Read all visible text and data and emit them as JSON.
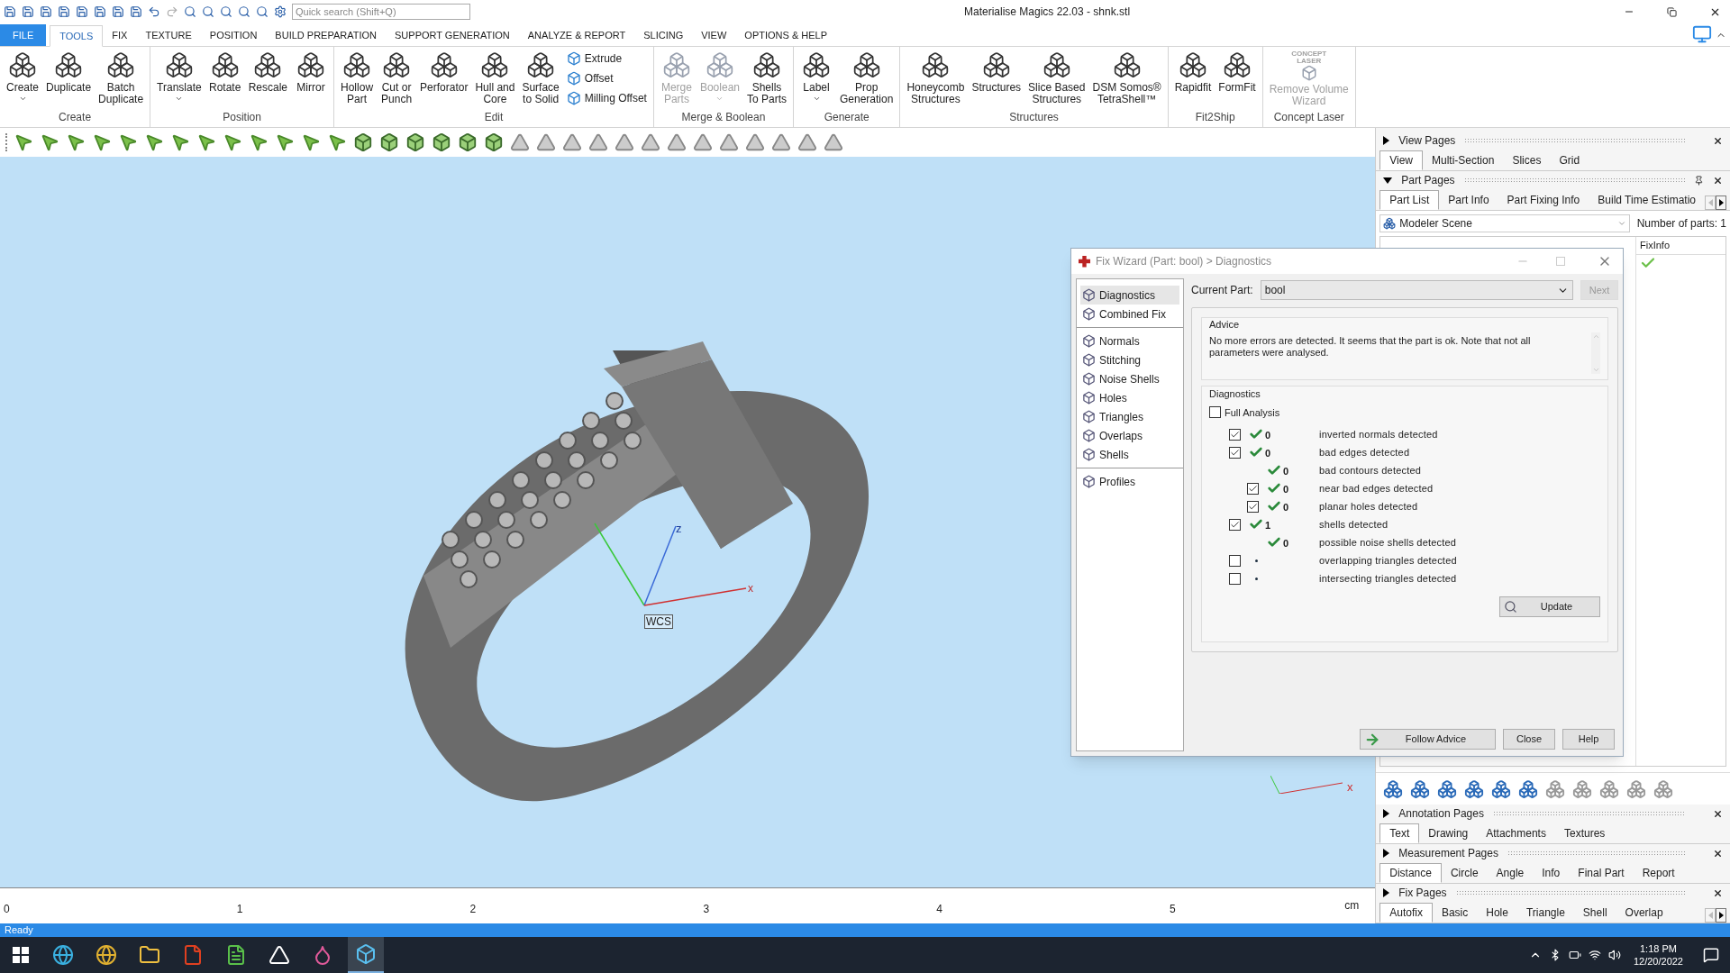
{
  "window": {
    "title": "Materialise Magics 22.03 - shnk.stl"
  },
  "quick_search": {
    "placeholder": "Quick search (Shift+Q)"
  },
  "menu_tabs": [
    {
      "label": "FILE",
      "kind": "file",
      "selected": false
    },
    {
      "label": "TOOLS",
      "kind": "tab",
      "selected": true
    },
    {
      "label": "FIX",
      "kind": "tab",
      "selected": false
    },
    {
      "label": "TEXTURE",
      "kind": "tab",
      "selected": false
    },
    {
      "label": "POSITION",
      "kind": "tab",
      "selected": false
    },
    {
      "label": "BUILD PREPARATION",
      "kind": "tab",
      "selected": false
    },
    {
      "label": "SUPPORT GENERATION",
      "kind": "tab",
      "selected": false
    },
    {
      "label": "ANALYZE & REPORT",
      "kind": "tab",
      "selected": false
    },
    {
      "label": "SLICING",
      "kind": "tab",
      "selected": false
    },
    {
      "label": "VIEW",
      "kind": "tab",
      "selected": false
    },
    {
      "label": "OPTIONS & HELP",
      "kind": "tab",
      "selected": false
    }
  ],
  "ribbon_groups": [
    {
      "label": "Create",
      "buttons": [
        {
          "label": "Create",
          "kind": "large",
          "dropdown": true,
          "disabled": false
        },
        {
          "label": "Duplicate",
          "kind": "large",
          "dropdown": false,
          "disabled": false
        },
        {
          "label": "Batch\nDuplicate",
          "kind": "large",
          "dropdown": false,
          "disabled": false
        }
      ]
    },
    {
      "label": "Position",
      "buttons": [
        {
          "label": "Translate",
          "kind": "large",
          "dropdown": true,
          "disabled": false
        },
        {
          "label": "Rotate",
          "kind": "large",
          "dropdown": false,
          "disabled": false
        },
        {
          "label": "Rescale",
          "kind": "large",
          "dropdown": false,
          "disabled": false
        },
        {
          "label": "Mirror",
          "kind": "large",
          "dropdown": false,
          "disabled": false
        }
      ]
    },
    {
      "label": "Edit",
      "buttons": [
        {
          "label": "Hollow\nPart",
          "kind": "large",
          "dropdown": false,
          "disabled": false
        },
        {
          "label": "Cut or\nPunch",
          "kind": "large",
          "dropdown": false,
          "disabled": false
        },
        {
          "label": "Perforator",
          "kind": "large",
          "dropdown": false,
          "disabled": false
        },
        {
          "label": "Hull and\nCore",
          "kind": "large",
          "dropdown": false,
          "disabled": false
        },
        {
          "label": "Surface\nto Solid",
          "kind": "large",
          "dropdown": false,
          "disabled": false
        },
        {
          "label": "Extrude",
          "kind": "small",
          "dropdown": false,
          "disabled": false
        },
        {
          "label": "Offset",
          "kind": "small",
          "dropdown": false,
          "disabled": false
        },
        {
          "label": "Milling Offset",
          "kind": "small",
          "dropdown": false,
          "disabled": false
        }
      ]
    },
    {
      "label": "Merge & Boolean",
      "buttons": [
        {
          "label": "Merge\nParts",
          "kind": "large",
          "dropdown": false,
          "disabled": true
        },
        {
          "label": "Boolean",
          "kind": "large",
          "dropdown": true,
          "disabled": true
        },
        {
          "label": "Shells\nTo Parts",
          "kind": "large",
          "dropdown": false,
          "disabled": false
        }
      ]
    },
    {
      "label": "Generate",
      "buttons": [
        {
          "label": "Label",
          "kind": "large",
          "dropdown": true,
          "disabled": false
        },
        {
          "label": "Prop\nGeneration",
          "kind": "large",
          "dropdown": false,
          "disabled": false
        }
      ]
    },
    {
      "label": "Structures",
      "buttons": [
        {
          "label": "Honeycomb\nStructures",
          "kind": "large",
          "dropdown": false,
          "disabled": false
        },
        {
          "label": "Structures",
          "kind": "large",
          "dropdown": false,
          "disabled": false
        },
        {
          "label": "Slice Based\nStructures",
          "kind": "large",
          "dropdown": false,
          "disabled": false
        },
        {
          "label": "DSM Somos®\nTetraShell™",
          "kind": "large",
          "dropdown": false,
          "disabled": false
        }
      ]
    },
    {
      "label": "Fit2Ship",
      "buttons": [
        {
          "label": "Rapidfit",
          "kind": "large",
          "dropdown": false,
          "disabled": false
        },
        {
          "label": "FormFit",
          "kind": "large",
          "dropdown": false,
          "disabled": false
        }
      ]
    },
    {
      "label": "Concept Laser",
      "buttons": [
        {
          "label": "Remove Volume\nWizard",
          "kind": "large",
          "dropdown": false,
          "disabled": true,
          "logo": "CONCEPT\nLASER"
        }
      ]
    }
  ],
  "viewport": {
    "axis_labels": [
      "x",
      "z"
    ],
    "wcs_label": "WCS",
    "corner_axis_label": "x"
  },
  "ruler": {
    "ticks": [
      "0",
      "1",
      "2",
      "3",
      "4",
      "5"
    ],
    "unit": "cm"
  },
  "panels": [
    {
      "title": "View Pages",
      "expanded": false,
      "pinned": false,
      "tabs": [
        {
          "label": "View",
          "selected": true
        },
        {
          "label": "Multi-Section",
          "selected": false
        },
        {
          "label": "Slices",
          "selected": false
        },
        {
          "label": "Grid",
          "selected": false
        }
      ]
    },
    {
      "title": "Part Pages",
      "expanded": true,
      "pinned": true,
      "tabs": [
        {
          "label": "Part List",
          "selected": true
        },
        {
          "label": "Part Info",
          "selected": false
        },
        {
          "label": "Part Fixing Info",
          "selected": false
        },
        {
          "label": "Build Time Estimatio",
          "selected": false
        }
      ],
      "scene": "Modeler Scene",
      "parts_count": "Number of parts: 1",
      "table": {
        "columns": [
          "FixInfo"
        ],
        "rows": [
          {
            "fix_ok": true
          }
        ]
      }
    },
    {
      "title": "Annotation Pages",
      "expanded": false,
      "pinned": false,
      "tabs": [
        {
          "label": "Text",
          "selected": true
        },
        {
          "label": "Drawing",
          "selected": false
        },
        {
          "label": "Attachments",
          "selected": false
        },
        {
          "label": "Textures",
          "selected": false
        }
      ]
    },
    {
      "title": "Measurement Pages",
      "expanded": false,
      "pinned": false,
      "tabs": [
        {
          "label": "Distance",
          "selected": true
        },
        {
          "label": "Circle",
          "selected": false
        },
        {
          "label": "Angle",
          "selected": false
        },
        {
          "label": "Info",
          "selected": false
        },
        {
          "label": "Final Part",
          "selected": false
        },
        {
          "label": "Report",
          "selected": false
        }
      ]
    },
    {
      "title": "Fix Pages",
      "expanded": false,
      "pinned": false,
      "tabs": [
        {
          "label": "Autofix",
          "selected": true
        },
        {
          "label": "Basic",
          "selected": false
        },
        {
          "label": "Hole",
          "selected": false
        },
        {
          "label": "Triangle",
          "selected": false
        },
        {
          "label": "Shell",
          "selected": false
        },
        {
          "label": "Overlap",
          "selected": false
        }
      ]
    }
  ],
  "dialog": {
    "title": "Fix Wizard (Part: bool) > Diagnostics",
    "nav": [
      [
        {
          "label": "Diagnostics",
          "selected": true
        },
        {
          "label": "Combined Fix",
          "selected": false
        }
      ],
      [
        {
          "label": "Normals",
          "selected": false
        },
        {
          "label": "Stitching",
          "selected": false
        },
        {
          "label": "Noise Shells",
          "selected": false
        },
        {
          "label": "Holes",
          "selected": false
        },
        {
          "label": "Triangles",
          "selected": false
        },
        {
          "label": "Overlaps",
          "selected": false
        },
        {
          "label": "Shells",
          "selected": false
        }
      ],
      [
        {
          "label": "Profiles",
          "selected": false
        }
      ]
    ],
    "current_part_label": "Current Part:",
    "current_part": "bool",
    "next_button": {
      "label": "Next",
      "disabled": true
    },
    "advice_title": "Advice",
    "advice": "No more errors are detected. It seems that the part is ok. Note that not all parameters were analysed.",
    "diagnostics_title": "Diagnostics",
    "full_analysis": {
      "label": "Full Analysis",
      "checked": false
    },
    "rows": [
      {
        "kind": "check",
        "checked": true,
        "ok": true,
        "count": "0",
        "label": "inverted normals detected"
      },
      {
        "kind": "check",
        "checked": true,
        "ok": true,
        "count": "0",
        "label": "bad edges detected",
        "children": [
          {
            "kind": "plain",
            "ok": true,
            "count": "0",
            "label": "bad contours detected"
          },
          {
            "kind": "check",
            "checked": true,
            "ok": true,
            "count": "0",
            "label": "near bad edges detected"
          },
          {
            "kind": "check",
            "checked": true,
            "ok": true,
            "count": "0",
            "label": "planar holes detected"
          }
        ]
      },
      {
        "kind": "check",
        "checked": true,
        "ok": true,
        "count": "1",
        "label": "shells detected",
        "children": [
          {
            "kind": "plain",
            "ok": true,
            "count": "0",
            "label": "possible noise shells detected"
          }
        ]
      },
      {
        "kind": "check",
        "checked": false,
        "ok": false,
        "label": "overlapping triangles detected"
      },
      {
        "kind": "check",
        "checked": false,
        "ok": false,
        "label": "intersecting triangles detected"
      }
    ],
    "update_button": "Update",
    "buttons": [
      "Follow Advice",
      "Close",
      "Help"
    ]
  },
  "status_bar": {
    "text": "Ready"
  },
  "taskbar": {
    "time": "1:18 PM",
    "date": "12/20/2022"
  }
}
